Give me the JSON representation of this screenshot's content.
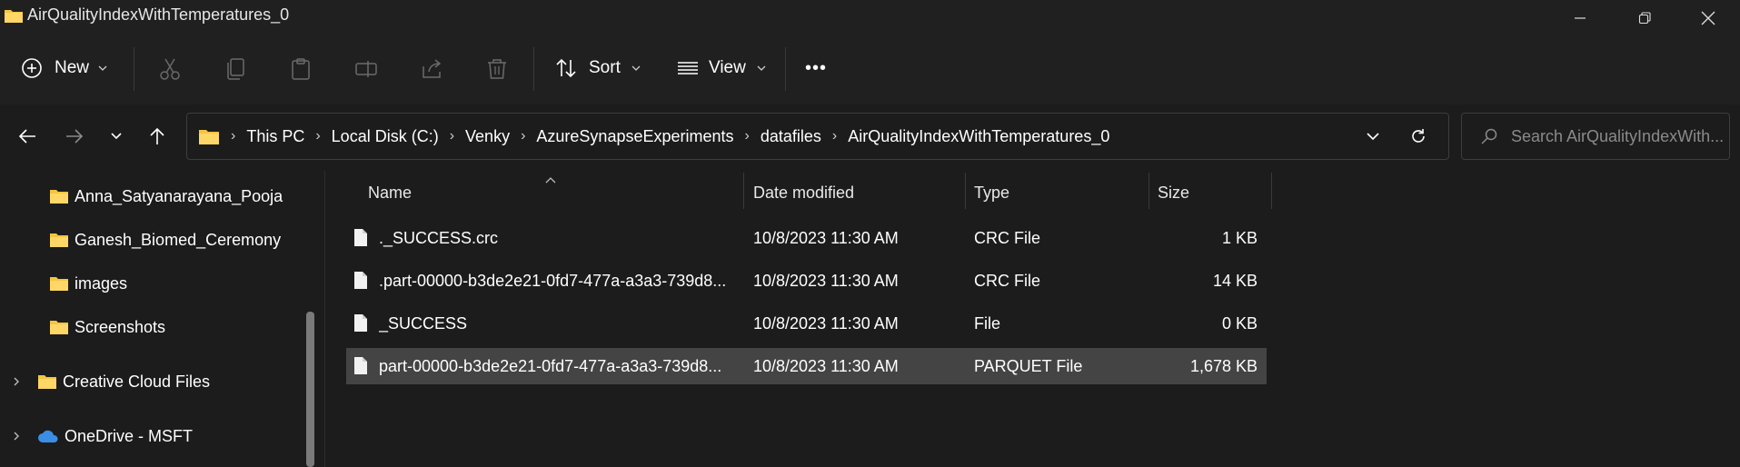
{
  "window": {
    "title": "AirQualityIndexWithTemperatures_0"
  },
  "toolbar": {
    "new_label": "New",
    "sort_label": "Sort",
    "view_label": "View",
    "more_label": "•••"
  },
  "address": {
    "crumbs": [
      "This PC",
      "Local Disk (C:)",
      "Venky",
      "AzureSynapseExperiments",
      "datafiles",
      "AirQualityIndexWithTemperatures_0"
    ]
  },
  "search": {
    "placeholder": "Search AirQualityIndexWith..."
  },
  "sidebar": {
    "items": [
      {
        "label": "Anna_Satyanarayana_Pooja"
      },
      {
        "label": "Ganesh_Biomed_Ceremony"
      },
      {
        "label": "images"
      },
      {
        "label": "Screenshots"
      },
      {
        "label": "Creative Cloud Files"
      },
      {
        "label": "OneDrive - MSFT"
      }
    ]
  },
  "files": {
    "headers": {
      "name": "Name",
      "date": "Date modified",
      "type": "Type",
      "size": "Size"
    },
    "rows": [
      {
        "name": "._SUCCESS.crc",
        "date": "10/8/2023 11:30 AM",
        "type": "CRC File",
        "size": "1 KB"
      },
      {
        "name": ".part-00000-b3de2e21-0fd7-477a-a3a3-739d8...",
        "date": "10/8/2023 11:30 AM",
        "type": "CRC File",
        "size": "14 KB"
      },
      {
        "name": "_SUCCESS",
        "date": "10/8/2023 11:30 AM",
        "type": "File",
        "size": "0 KB"
      },
      {
        "name": "part-00000-b3de2e21-0fd7-477a-a3a3-739d8...",
        "date": "10/8/2023 11:30 AM",
        "type": "PARQUET File",
        "size": "1,678 KB"
      }
    ]
  },
  "colors": {
    "folder": "#f4c542",
    "onedrive": "#3a8ee6",
    "selected_row": "#444444"
  }
}
